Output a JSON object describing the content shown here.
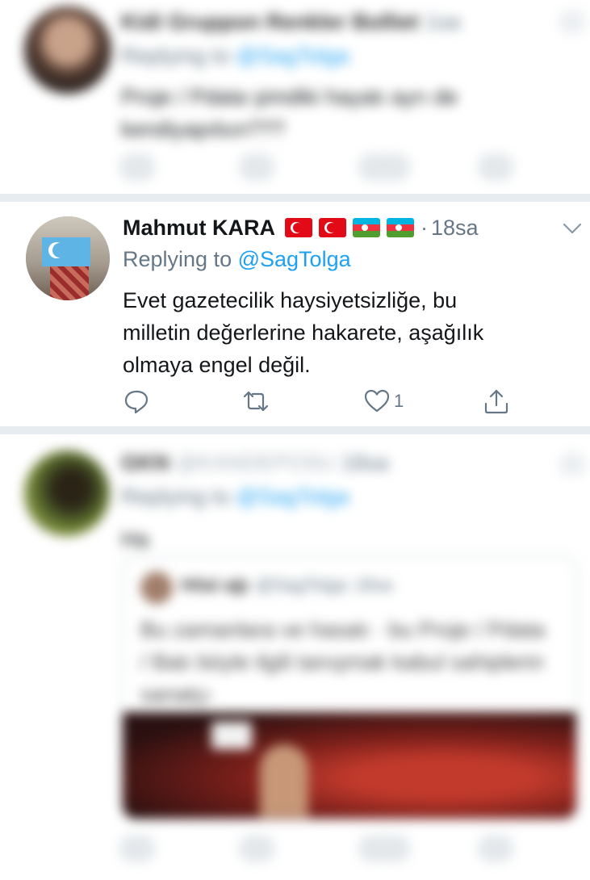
{
  "top_tweet": {
    "name": "Kidi Gruppon Renkler Bolliet",
    "time": "1sa",
    "replying_prefix": "Replying to",
    "mention": "@SagTolga",
    "text": "Proje / Pdata şimdiki hayatı ayrı de kendiyapılsın???"
  },
  "main_tweet": {
    "name": "Mahmut KARA",
    "flags": [
      "turkey",
      "turkey",
      "azerbaijan",
      "azerbaijan"
    ],
    "separator": "·",
    "time": "18sa",
    "replying_prefix": "Replying to",
    "mention": "@SagTolga",
    "text_lines": [
      "Evet gazetecilik haysiyetsizliğe, bu",
      "milletin değerlerine hakarete, aşağılık",
      "olmaya engel değil."
    ],
    "actions": {
      "reply_icon": "reply-icon",
      "retweet_icon": "retweet-icon",
      "like_icon": "heart-icon",
      "like_count": "1",
      "share_icon": "share-icon"
    }
  },
  "bottom_tweet": {
    "name": "GKN",
    "handle": "@KANDEPOSU",
    "time": "18sa",
    "replying_prefix": "Replying to",
    "mention": "@SagTolga",
    "text": "Ha",
    "quote": {
      "name": "Hilal ağı",
      "handle": "@SagTolga",
      "time": "18sa",
      "text": "Bu zamanlara ve hasatı · bu Proje / Pdata / Batı böyle ilgili tanışmak kabul sahiplerin sanatçı"
    }
  },
  "colors": {
    "link": "#1da1f2",
    "secondary_text": "#657786",
    "divider": "#e6ecf0"
  }
}
